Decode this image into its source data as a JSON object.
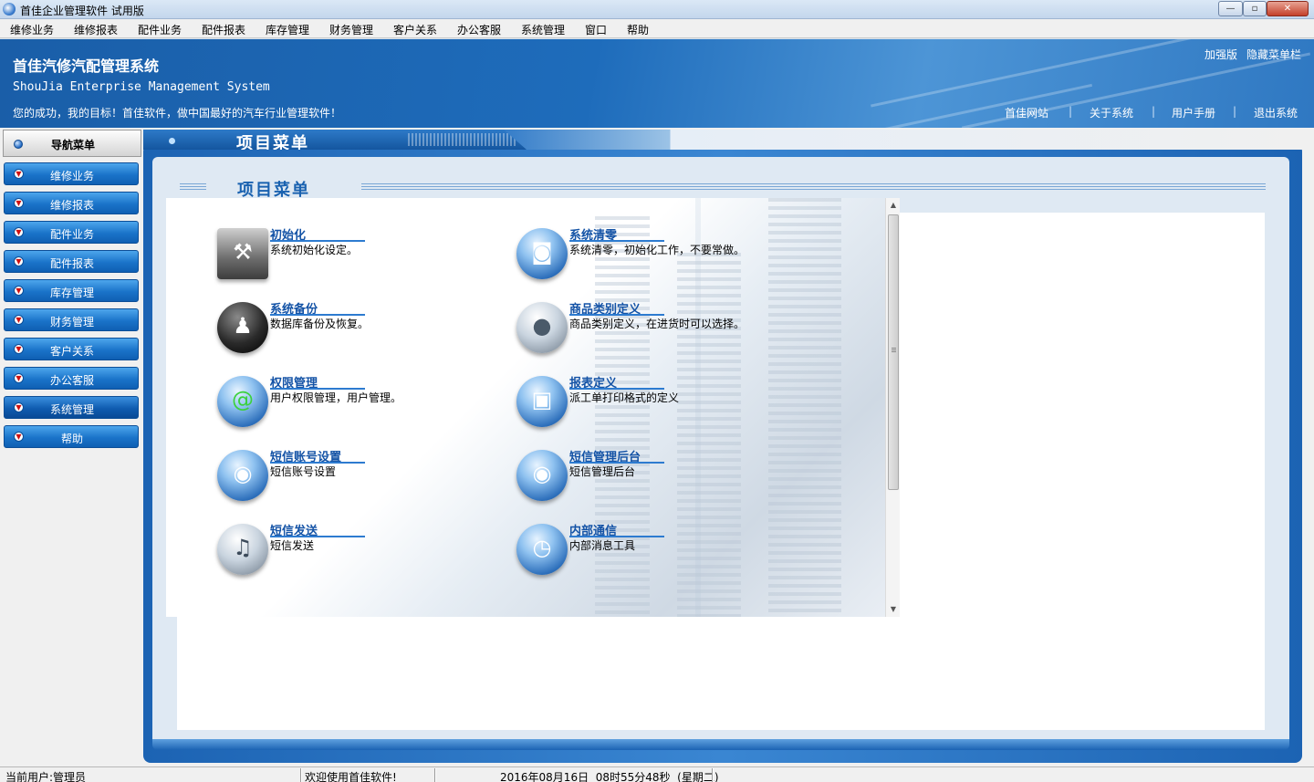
{
  "window": {
    "title": "首佳企业管理软件 试用版",
    "buttons": {
      "minimize": "—",
      "maximize": "▫",
      "close": "✕"
    }
  },
  "menubar": [
    "维修业务",
    "维修报表",
    "配件业务",
    "配件报表",
    "库存管理",
    "财务管理",
    "客户关系",
    "办公客服",
    "系统管理",
    "窗口",
    "帮助"
  ],
  "banner": {
    "title": "首佳汽修汽配管理系统",
    "subtitle": "ShouJia Enterprise Management System",
    "slogan": "您的成功，我的目标！首佳软件，做中国最好的汽车行业管理软件！",
    "top_links": [
      "加强版",
      "隐藏菜单栏"
    ],
    "bottom_links": [
      "首佳网站",
      "关于系统",
      "用户手册",
      "退出系统"
    ],
    "separator": "|"
  },
  "sidebar": {
    "header": "导航菜单",
    "items": [
      "维修业务",
      "维修报表",
      "配件业务",
      "配件报表",
      "库存管理",
      "财务管理",
      "客户关系",
      "办公客服",
      "系统管理",
      "帮助"
    ],
    "active": "系统管理"
  },
  "main": {
    "tab_title": "项目菜单",
    "section_title": "项目菜单",
    "items": [
      {
        "name": "初始化",
        "desc": "系统初始化设定。",
        "icon": "tools-icon"
      },
      {
        "name": "系统清零",
        "desc": "系统清零，初始化工作，不要常做。",
        "icon": "camera-icon"
      },
      {
        "name": "系统备份",
        "desc": "数据库备份及恢复。",
        "icon": "users-icon"
      },
      {
        "name": "商品类别定义",
        "desc": "商品类别定义，在进货时可以选择。",
        "icon": "apple-icon"
      },
      {
        "name": "权限管理",
        "desc": "用户权限管理，用户管理。",
        "icon": "at-icon"
      },
      {
        "name": "报表定义",
        "desc": "派工单打印格式的定义",
        "icon": "floppy-icon"
      },
      {
        "name": "短信账号设置",
        "desc": "短信账号设置",
        "icon": "globe-icon"
      },
      {
        "name": "短信管理后台",
        "desc": "短信管理后台",
        "icon": "globe-icon"
      },
      {
        "name": "短信发送",
        "desc": "短信发送",
        "icon": "music-icon"
      },
      {
        "name": "内部通信",
        "desc": "内部消息工具",
        "icon": "clock-icon"
      }
    ]
  },
  "statusbar": {
    "user": "当前用户:管理员",
    "message": "欢迎使用首佳软件!",
    "datetime": "2016年08月16日  08时55分48秒  (星期二)"
  },
  "colors": {
    "accent": "#1a62b0",
    "link": "#1453a6",
    "nav_button": "#1a73c9"
  }
}
